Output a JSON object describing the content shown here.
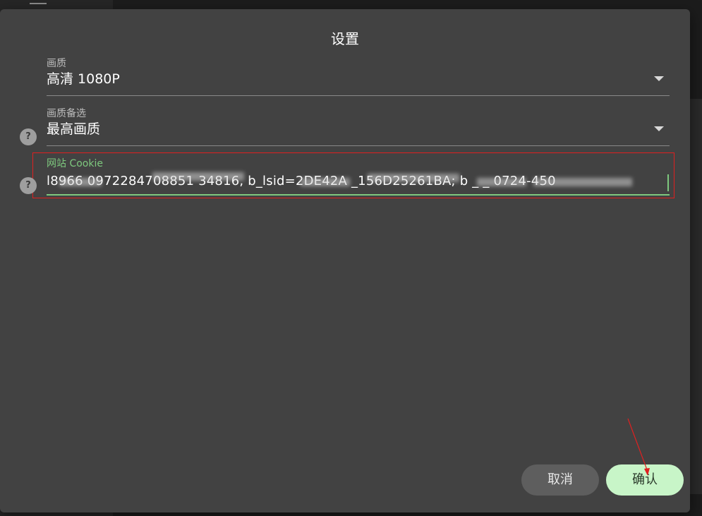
{
  "dialog": {
    "title": "设置",
    "fields": [
      {
        "label": "画质",
        "value": "高清 1080P"
      },
      {
        "label": "画质备选",
        "value": "最高画质"
      },
      {
        "label": "网站 Cookie",
        "value": "l8966 0972284708851 34816, b_lsid=2DE42A _156D25261BA; b _ _ 0724-450"
      }
    ],
    "help_glyph": "?",
    "buttons": {
      "cancel": "取消",
      "confirm": "确认"
    }
  },
  "colors": {
    "dialog_bg": "#424242",
    "accent_green": "#7ec87e",
    "confirm_bg": "#c8f5c8",
    "cancel_bg": "#5e5e5e",
    "annotation_red": "#e02020"
  }
}
